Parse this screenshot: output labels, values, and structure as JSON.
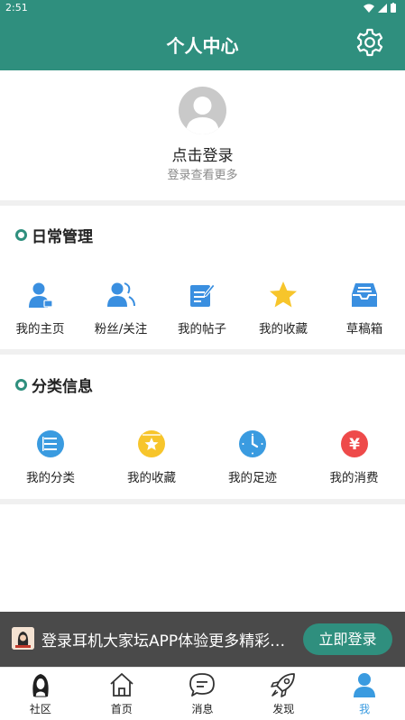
{
  "status_bar": {
    "time": "2:51"
  },
  "header": {
    "title": "个人中心"
  },
  "profile": {
    "login_text": "点击登录",
    "login_sub": "登录查看更多"
  },
  "daily": {
    "title": "日常管理",
    "items": [
      {
        "label": "我的主页",
        "icon": "user-home-icon"
      },
      {
        "label": "粉丝/关注",
        "icon": "followers-icon"
      },
      {
        "label": "我的帖子",
        "icon": "post-edit-icon"
      },
      {
        "label": "我的收藏",
        "icon": "star-icon"
      },
      {
        "label": "草稿箱",
        "icon": "drafts-inbox-icon"
      }
    ]
  },
  "category": {
    "title": "分类信息",
    "items": [
      {
        "label": "我的分类",
        "icon": "list-icon"
      },
      {
        "label": "我的收藏",
        "icon": "star-badge-icon"
      },
      {
        "label": "我的足迹",
        "icon": "clock-icon"
      },
      {
        "label": "我的消费",
        "icon": "yuan-icon"
      }
    ],
    "yuan_symbol": "¥"
  },
  "banner": {
    "text": "登录耳机大家坛APP体验更多精彩内容",
    "button": "立即登录"
  },
  "bottom_nav": {
    "items": [
      {
        "label": "社区",
        "icon": "community-avatar-icon"
      },
      {
        "label": "首页",
        "icon": "home-icon"
      },
      {
        "label": "消息",
        "icon": "message-icon"
      },
      {
        "label": "发现",
        "icon": "rocket-icon"
      },
      {
        "label": "我",
        "icon": "user-icon"
      }
    ],
    "active_index": 4
  },
  "colors": {
    "primary": "#2f8f7e",
    "accent_blue": "#3a9be0",
    "banner_bg": "#4a4a4a"
  }
}
